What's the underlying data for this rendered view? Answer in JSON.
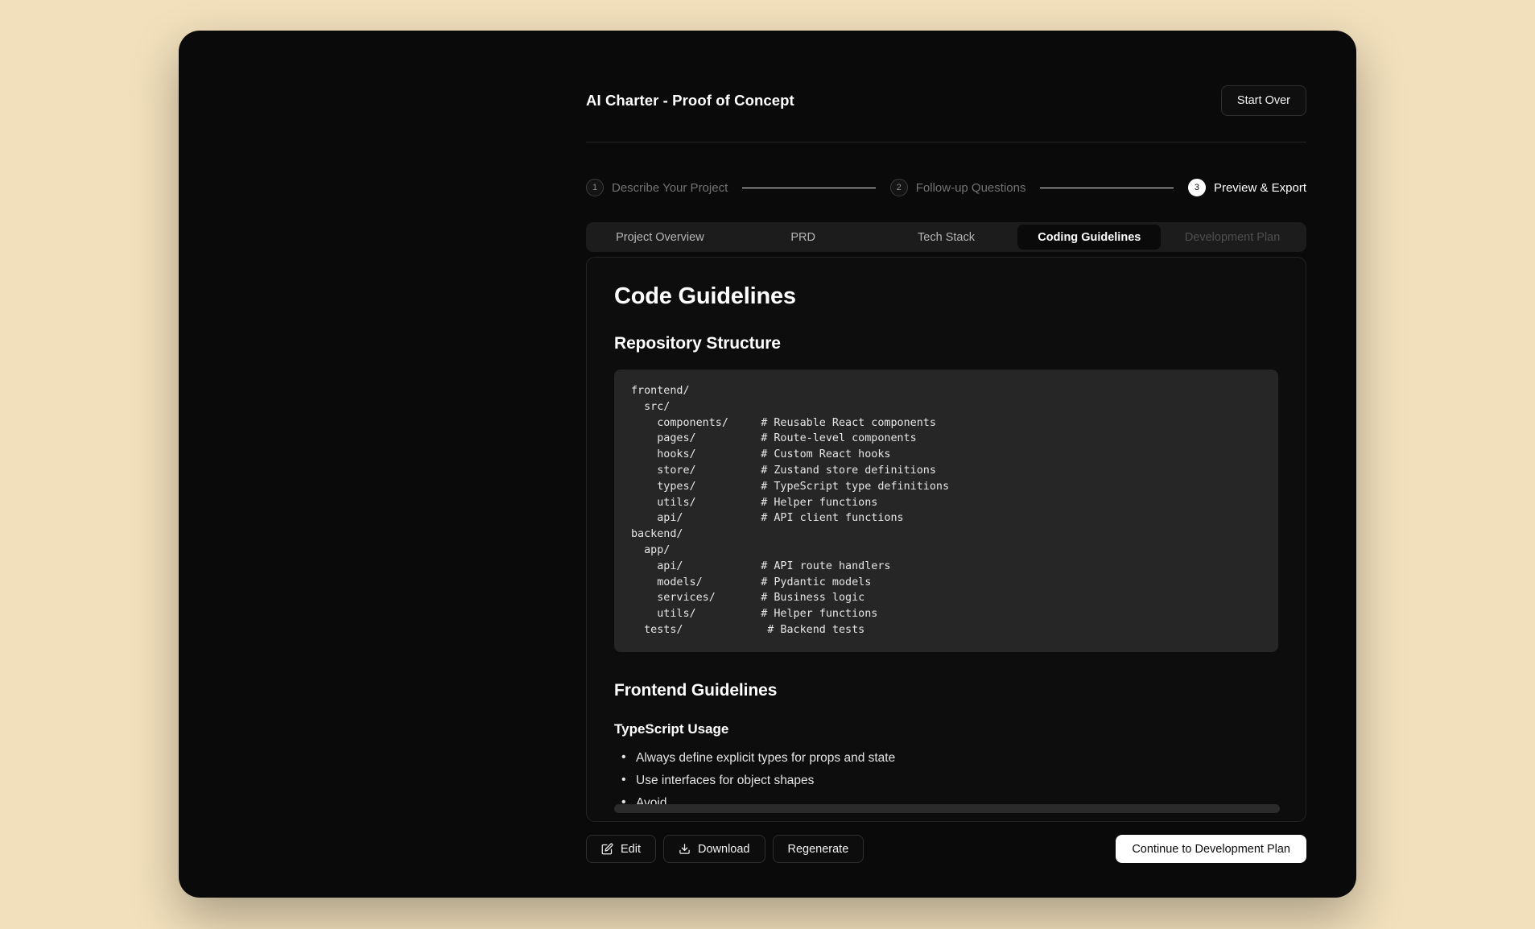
{
  "header": {
    "title": "AI Charter - Proof of Concept",
    "start_over_label": "Start Over"
  },
  "stepper": {
    "steps": [
      {
        "number": "1",
        "label": "Describe Your Project",
        "state": "inactive"
      },
      {
        "number": "2",
        "label": "Follow-up Questions",
        "state": "inactive"
      },
      {
        "number": "3",
        "label": "Preview & Export",
        "state": "active"
      }
    ]
  },
  "tabs": [
    {
      "label": "Project Overview",
      "state": "normal"
    },
    {
      "label": "PRD",
      "state": "normal"
    },
    {
      "label": "Tech Stack",
      "state": "normal"
    },
    {
      "label": "Coding Guidelines",
      "state": "active"
    },
    {
      "label": "Development Plan",
      "state": "dimmed"
    }
  ],
  "document": {
    "title": "Code Guidelines",
    "repository_structure_heading": "Repository Structure",
    "repository_structure_code": "frontend/\n  src/\n    components/     # Reusable React components\n    pages/          # Route-level components\n    hooks/          # Custom React hooks\n    store/          # Zustand store definitions\n    types/          # TypeScript type definitions\n    utils/          # Helper functions\n    api/            # API client functions\nbackend/\n  app/\n    api/            # API route handlers\n    models/         # Pydantic models\n    services/       # Business logic\n    utils/          # Helper functions\n  tests/             # Backend tests",
    "frontend_guidelines_heading": "Frontend Guidelines",
    "typescript_usage_heading": "TypeScript Usage",
    "typescript_bullets": [
      "Always define explicit types for props and state",
      "Use interfaces for object shapes",
      "Avoid"
    ]
  },
  "footer": {
    "edit_label": "Edit",
    "download_label": "Download",
    "regenerate_label": "Regenerate",
    "continue_label": "Continue to Development Plan"
  },
  "colors": {
    "page_background": "#f2e0bc",
    "window_background": "#0a0a0a",
    "card_background": "#0d0d0d",
    "code_background": "#262626",
    "accent_white": "#ffffff"
  }
}
